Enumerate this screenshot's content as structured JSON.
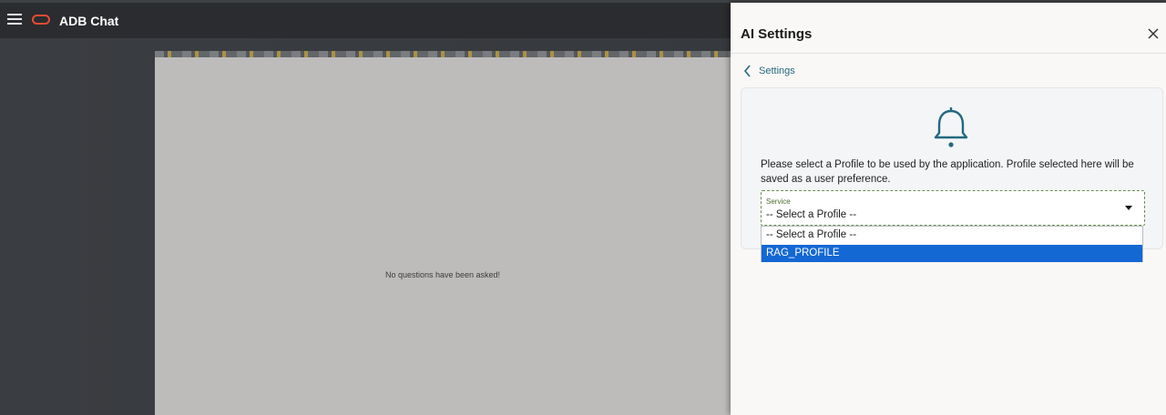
{
  "header": {
    "app_title": "ADB Chat",
    "menu_icon": "hamburger-menu-icon",
    "logo_icon": "oracle-logo-icon"
  },
  "main": {
    "empty_message": "No questions have been asked!"
  },
  "drawer": {
    "title": "AI Settings",
    "close_icon": "close-icon",
    "back_link_label": "Settings",
    "card": {
      "icon": "bell-icon",
      "message": "Please select a Profile to be used by the application. Profile selected here will be saved as a user preference.",
      "select": {
        "label": "Service",
        "value": "-- Select a Profile --",
        "options": [
          "-- Select a Profile --",
          "RAG_PROFILE"
        ],
        "highlighted_option": "RAG_PROFILE"
      }
    }
  },
  "colors": {
    "accent": "#23697f",
    "highlight": "#1468d4",
    "logo": "#e84a37"
  }
}
